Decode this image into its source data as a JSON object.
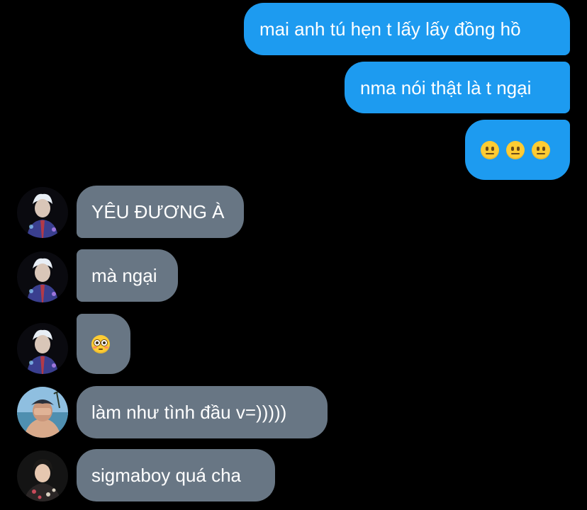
{
  "colors": {
    "background": "#000000",
    "outgoing_bubble": "#1d9bf0",
    "incoming_bubble": "#687684",
    "text": "#ffffff"
  },
  "messages": [
    {
      "direction": "outgoing",
      "text": "mai anh tú hẹn t lấy lấy đồng hồ"
    },
    {
      "direction": "outgoing",
      "text": "nma nói thật là t ngại"
    },
    {
      "direction": "outgoing",
      "emojis": [
        "neutral-face",
        "neutral-face",
        "neutral-face"
      ]
    },
    {
      "direction": "incoming",
      "avatar": "avatar-user-1-icon",
      "text": "YÊU ĐƯƠNG À"
    },
    {
      "direction": "incoming",
      "avatar": "avatar-user-1-icon",
      "text": "mà ngại"
    },
    {
      "direction": "incoming",
      "avatar": "avatar-user-1-icon",
      "emojis": [
        "flushed-face"
      ]
    },
    {
      "direction": "incoming",
      "avatar": "avatar-user-2-icon",
      "text": "làm như tình đầu v=)))))"
    },
    {
      "direction": "incoming",
      "avatar": "avatar-user-3-icon",
      "text": "sigmaboy quá cha"
    }
  ]
}
